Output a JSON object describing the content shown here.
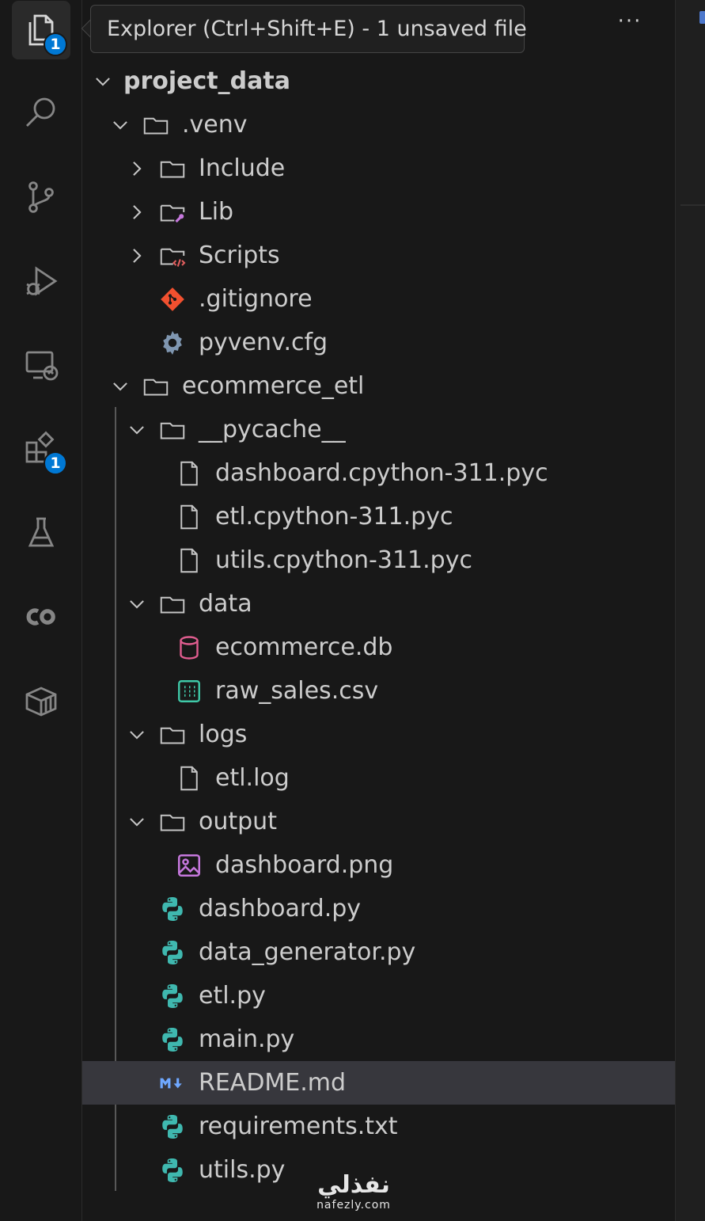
{
  "tooltip": {
    "text": "Explorer (Ctrl+Shift+E) - 1 unsaved file"
  },
  "more_actions": "···",
  "activity_bar": {
    "explorer_badge": "1",
    "extensions_badge": "1"
  },
  "tree": [
    {
      "label": "project_data",
      "depth": 0,
      "type": "root",
      "expanded": true
    },
    {
      "label": ".venv",
      "depth": 1,
      "type": "folder",
      "expanded": true
    },
    {
      "label": "Include",
      "depth": 2,
      "type": "folder",
      "expanded": false
    },
    {
      "label": "Lib",
      "depth": 2,
      "type": "folder-lib",
      "expanded": false
    },
    {
      "label": "Scripts",
      "depth": 2,
      "type": "folder-scripts",
      "expanded": false
    },
    {
      "label": ".gitignore",
      "depth": 2,
      "type": "git"
    },
    {
      "label": "pyvenv.cfg",
      "depth": 2,
      "type": "gear"
    },
    {
      "label": "ecommerce_etl",
      "depth": 1,
      "type": "folder",
      "expanded": true
    },
    {
      "label": "__pycache__",
      "depth": 2,
      "type": "folder",
      "expanded": true
    },
    {
      "label": "dashboard.cpython-311.pyc",
      "depth": 3,
      "type": "file"
    },
    {
      "label": "etl.cpython-311.pyc",
      "depth": 3,
      "type": "file"
    },
    {
      "label": "utils.cpython-311.pyc",
      "depth": 3,
      "type": "file"
    },
    {
      "label": "data",
      "depth": 2,
      "type": "folder",
      "expanded": true
    },
    {
      "label": "ecommerce.db",
      "depth": 3,
      "type": "db"
    },
    {
      "label": "raw_sales.csv",
      "depth": 3,
      "type": "csv"
    },
    {
      "label": "logs",
      "depth": 2,
      "type": "folder",
      "expanded": true
    },
    {
      "label": "etl.log",
      "depth": 3,
      "type": "file"
    },
    {
      "label": "output",
      "depth": 2,
      "type": "folder",
      "expanded": true
    },
    {
      "label": "dashboard.png",
      "depth": 3,
      "type": "image"
    },
    {
      "label": "dashboard.py",
      "depth": 2,
      "type": "python"
    },
    {
      "label": "data_generator.py",
      "depth": 2,
      "type": "python"
    },
    {
      "label": "etl.py",
      "depth": 2,
      "type": "python"
    },
    {
      "label": "main.py",
      "depth": 2,
      "type": "python"
    },
    {
      "label": "README.md",
      "depth": 2,
      "type": "markdown",
      "selected": true
    },
    {
      "label": "requirements.txt",
      "depth": 2,
      "type": "python"
    },
    {
      "label": "utils.py",
      "depth": 2,
      "type": "python"
    }
  ],
  "watermark": {
    "arabic": "نفذلي",
    "latin": "nafezly.com"
  },
  "colors": {
    "python": "#3fb8af",
    "folder": "#c5c5c5",
    "git": "#f1502f",
    "db": "#e05d8f",
    "csv": "#3fc9a8",
    "image": "#c678dd",
    "markdown": "#6fa8ff",
    "badge": "#0078d4"
  }
}
